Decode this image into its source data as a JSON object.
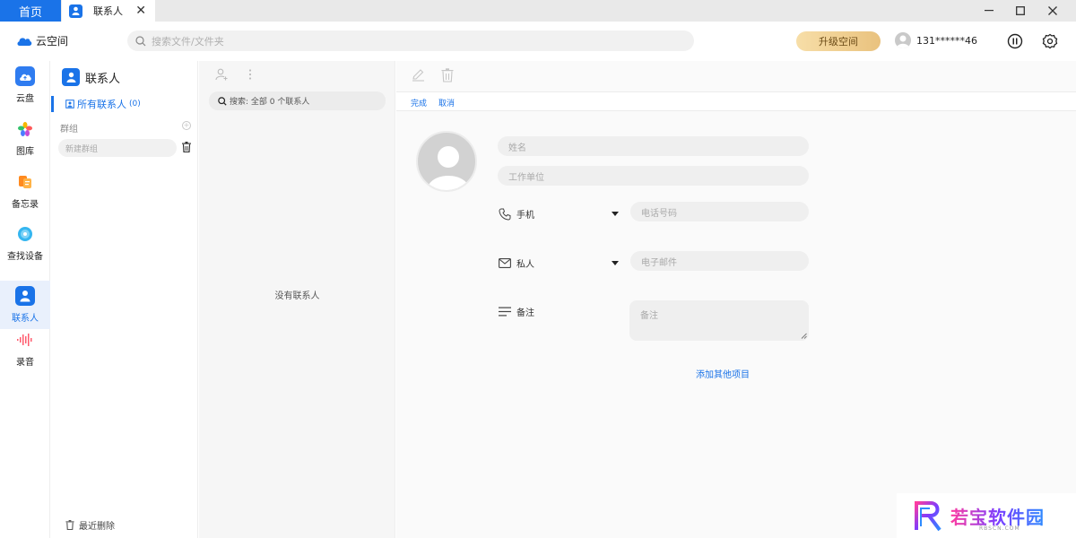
{
  "tabs": {
    "home": "首页",
    "contacts": "联系人",
    "close": "✕"
  },
  "window_controls": {
    "minimize": "—",
    "maximize": "☐",
    "close": "✕"
  },
  "topbar": {
    "brand": "云空间",
    "search_placeholder": "搜索文件/文件夹",
    "upgrade": "升级空间",
    "user": "131******46"
  },
  "leftnav": {
    "items": [
      {
        "label": "云盘",
        "icon": "cloud-drive-icon"
      },
      {
        "label": "图库",
        "icon": "gallery-icon"
      },
      {
        "label": "备忘录",
        "icon": "notes-icon"
      },
      {
        "label": "查找设备",
        "icon": "find-device-icon"
      },
      {
        "label": "联系人",
        "icon": "contacts-icon",
        "active": true
      },
      {
        "label": "录音",
        "icon": "recorder-icon"
      }
    ]
  },
  "groups": {
    "title": "联系人",
    "all_contacts": "所有联系人",
    "all_count": "(0)",
    "group_label": "群组",
    "new_group_placeholder": "新建群组",
    "recently_deleted": "最近删除"
  },
  "contact_list": {
    "search": "搜索: 全部 0 个联系人",
    "empty": "没有联系人"
  },
  "detail": {
    "done": "完成",
    "cancel": "取消",
    "name_placeholder": "姓名",
    "company_placeholder": "工作单位",
    "phone_label": "手机",
    "phone_placeholder": "电话号码",
    "email_label": "私人",
    "email_placeholder": "电子邮件",
    "notes_label": "备注",
    "notes_placeholder": "备注",
    "add_more": "添加其他项目"
  },
  "watermark": {
    "text": "若宝软件园",
    "sub": "RBSCN.COM"
  },
  "colors": {
    "accent": "#1a73e8",
    "upgrade_start": "#f7dea8",
    "upgrade_end": "#e9c27e"
  }
}
